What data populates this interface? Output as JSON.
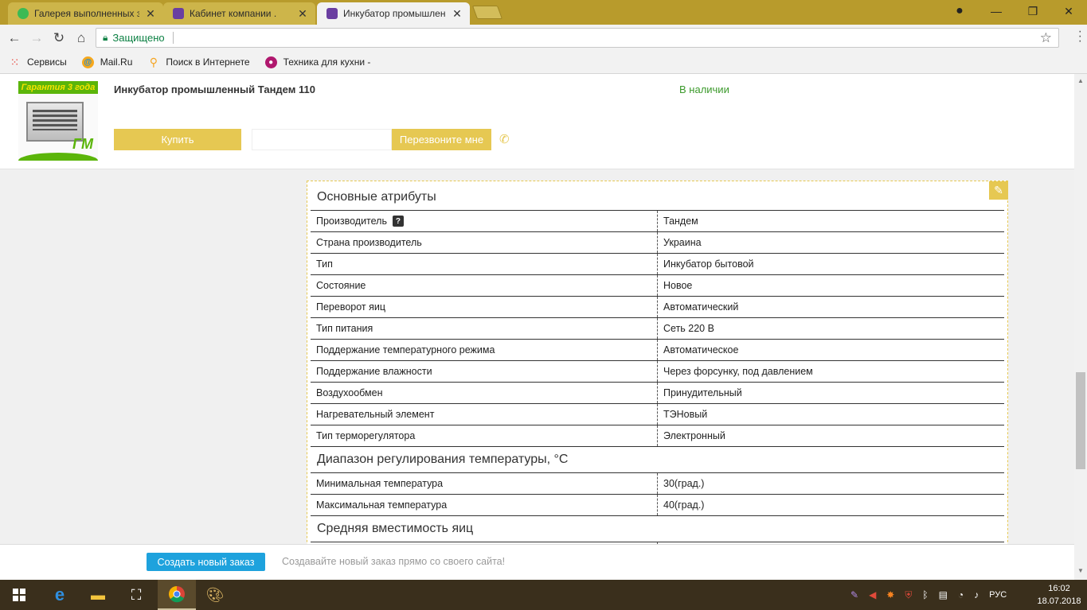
{
  "browser": {
    "tabs": [
      {
        "title": "Галерея выполненных з",
        "favicon_color": "#3cba54",
        "active": false
      },
      {
        "title": "Кабинет компании .",
        "favicon_color": "#6a3ea1",
        "active": false
      },
      {
        "title": "Инкубатор промышлен",
        "favicon_color": "#6a3ea1",
        "active": true
      }
    ],
    "close_symbol": "✕",
    "window_controls": {
      "minimize": "—",
      "maximize": "❐",
      "close": "✕"
    },
    "address": {
      "secure_label": "Защищено"
    }
  },
  "bookmarks": [
    {
      "label": "Сервисы",
      "icon": "apps-grid-icon",
      "color": "#e8453c"
    },
    {
      "label": "Mail.Ru",
      "icon": "mailru-icon",
      "color": "#168de2"
    },
    {
      "label": "Поиск в Интернете",
      "icon": "search-icon",
      "color": "#f5a623"
    },
    {
      "label": "Техника для кухни -",
      "icon": "store-icon",
      "color": "#b0186e"
    }
  ],
  "product": {
    "image_badge": "Гарантия 3 года",
    "image_logo": "ГМ",
    "title": "Инкубатор промышленный Тандем 110",
    "availability": "В наличии",
    "buy_label": "Купить",
    "callback_label": "Перезвоните мне"
  },
  "attributes": {
    "main": {
      "title": "Основные атрибуты",
      "rows": [
        {
          "name": "Производитель",
          "value": "Тандем",
          "help": "?"
        },
        {
          "name": "Страна производитель",
          "value": "Украина"
        },
        {
          "name": "Тип",
          "value": "Инкубатор бытовой"
        },
        {
          "name": "Состояние",
          "value": "Новое"
        },
        {
          "name": "Переворот яиц",
          "value": "Автоматический"
        },
        {
          "name": "Тип питания",
          "value": "Сеть 220 В"
        },
        {
          "name": "Поддержание температурного режима",
          "value": "Автоматическое"
        },
        {
          "name": "Поддержание влажности",
          "value": "Через форсунку, под давлением"
        },
        {
          "name": "Воздухообмен",
          "value": "Принудительный"
        },
        {
          "name": "Нагревательный элемент",
          "value": "ТЭНовый"
        },
        {
          "name": "Тип терморегулятора",
          "value": "Электронный"
        }
      ]
    },
    "temperature": {
      "title": "Диапазон регулирования температуры, °C",
      "rows": [
        {
          "name": "Минимальная температура",
          "value": "30(град.)"
        },
        {
          "name": "Максимальная температура",
          "value": "40(град.)"
        }
      ]
    },
    "capacity": {
      "title": "Средняя вместимость яиц"
    }
  },
  "bottom_bar": {
    "button": "Создать новый заказ",
    "hint": "Создавайте новый заказ прямо со своего сайта!"
  },
  "taskbar": {
    "language": "РУС",
    "time": "16:02",
    "date": "18.07.2018"
  },
  "colors": {
    "accent_yellow": "#e6c852",
    "availability_green": "#3c9a2c",
    "order_button_blue": "#1ea2dd",
    "chrome_frame": "#b89b2c"
  }
}
